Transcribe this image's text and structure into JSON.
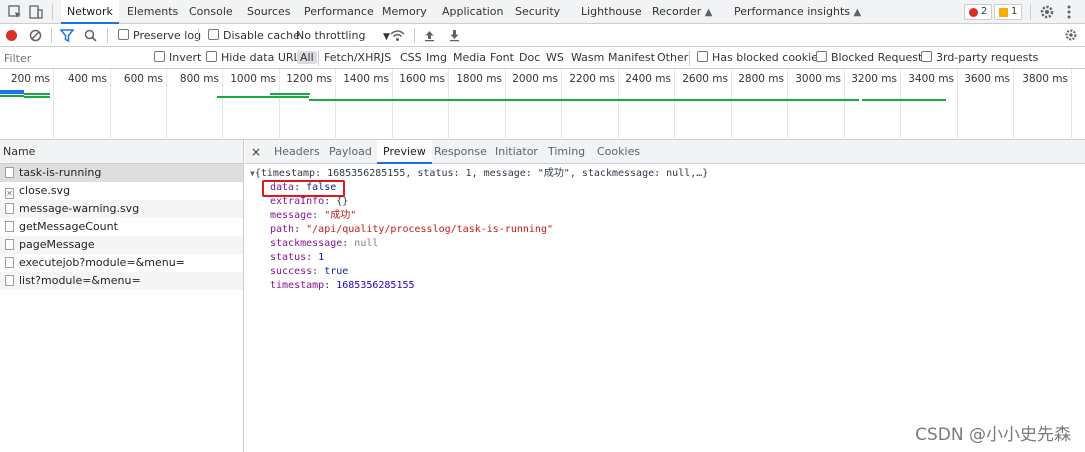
{
  "tabs": {
    "items": [
      "Network",
      "Elements",
      "Console",
      "Sources",
      "Performance",
      "Memory",
      "Application",
      "Security",
      "Lighthouse",
      "Recorder",
      "Performance insights"
    ],
    "errors_count": "2",
    "warnings_count": "1"
  },
  "toolbar": {
    "preserve_log": "Preserve log",
    "disable_cache": "Disable cache",
    "throttling": "No throttling"
  },
  "filter": {
    "placeholder": "Filter",
    "invert": "Invert",
    "hide_data_urls": "Hide data URLs",
    "types": [
      "All",
      "Fetch/XHR",
      "JS",
      "CSS",
      "Img",
      "Media",
      "Font",
      "Doc",
      "WS",
      "Wasm",
      "Manifest",
      "Other"
    ],
    "has_blocked_cookies": "Has blocked cookies",
    "blocked_requests": "Blocked Requests",
    "third_party": "3rd-party requests"
  },
  "overview": {
    "ticks": [
      "200 ms",
      "400 ms",
      "600 ms",
      "800 ms",
      "1000 ms",
      "1200 ms",
      "1400 ms",
      "1600 ms",
      "1800 ms",
      "2000 ms",
      "2200 ms",
      "2400 ms",
      "2600 ms",
      "2800 ms",
      "3000 ms",
      "3200 ms",
      "3400 ms",
      "3600 ms",
      "3800 ms"
    ]
  },
  "requests": {
    "header": "Name",
    "items": [
      "task-is-running",
      "close.svg",
      "message-warning.svg",
      "getMessageCount",
      "pageMessage",
      "executejob?module=&menu=",
      "list?module=&menu="
    ]
  },
  "detail": {
    "close": "×",
    "tabs": [
      "Headers",
      "Payload",
      "Preview",
      "Response",
      "Initiator",
      "Timing",
      "Cookies"
    ],
    "summary": "{timestamp: 1685356285155, status: 1, message: \"成功\", stackmessage: null,…}",
    "fields": [
      {
        "key": "data",
        "value": "false"
      },
      {
        "key": "extraInfo",
        "value": "{}"
      },
      {
        "key": "message",
        "value": "\"成功\""
      },
      {
        "key": "path",
        "value": "\"/api/quality/processlog/task-is-running\""
      },
      {
        "key": "stackmessage",
        "value": "null"
      },
      {
        "key": "status",
        "value": "1"
      },
      {
        "key": "success",
        "value": "true"
      },
      {
        "key": "timestamp",
        "value": "1685356285155"
      }
    ]
  },
  "watermark": "CSDN @小小史先森",
  "colors": {
    "accent": "#1a73e8",
    "highlight_box": "#e0181b",
    "error_dot": "#d93025",
    "warning_dot": "#f9ab00",
    "overview_green": "#1da93d",
    "overview_blue": "#1a73e8"
  }
}
